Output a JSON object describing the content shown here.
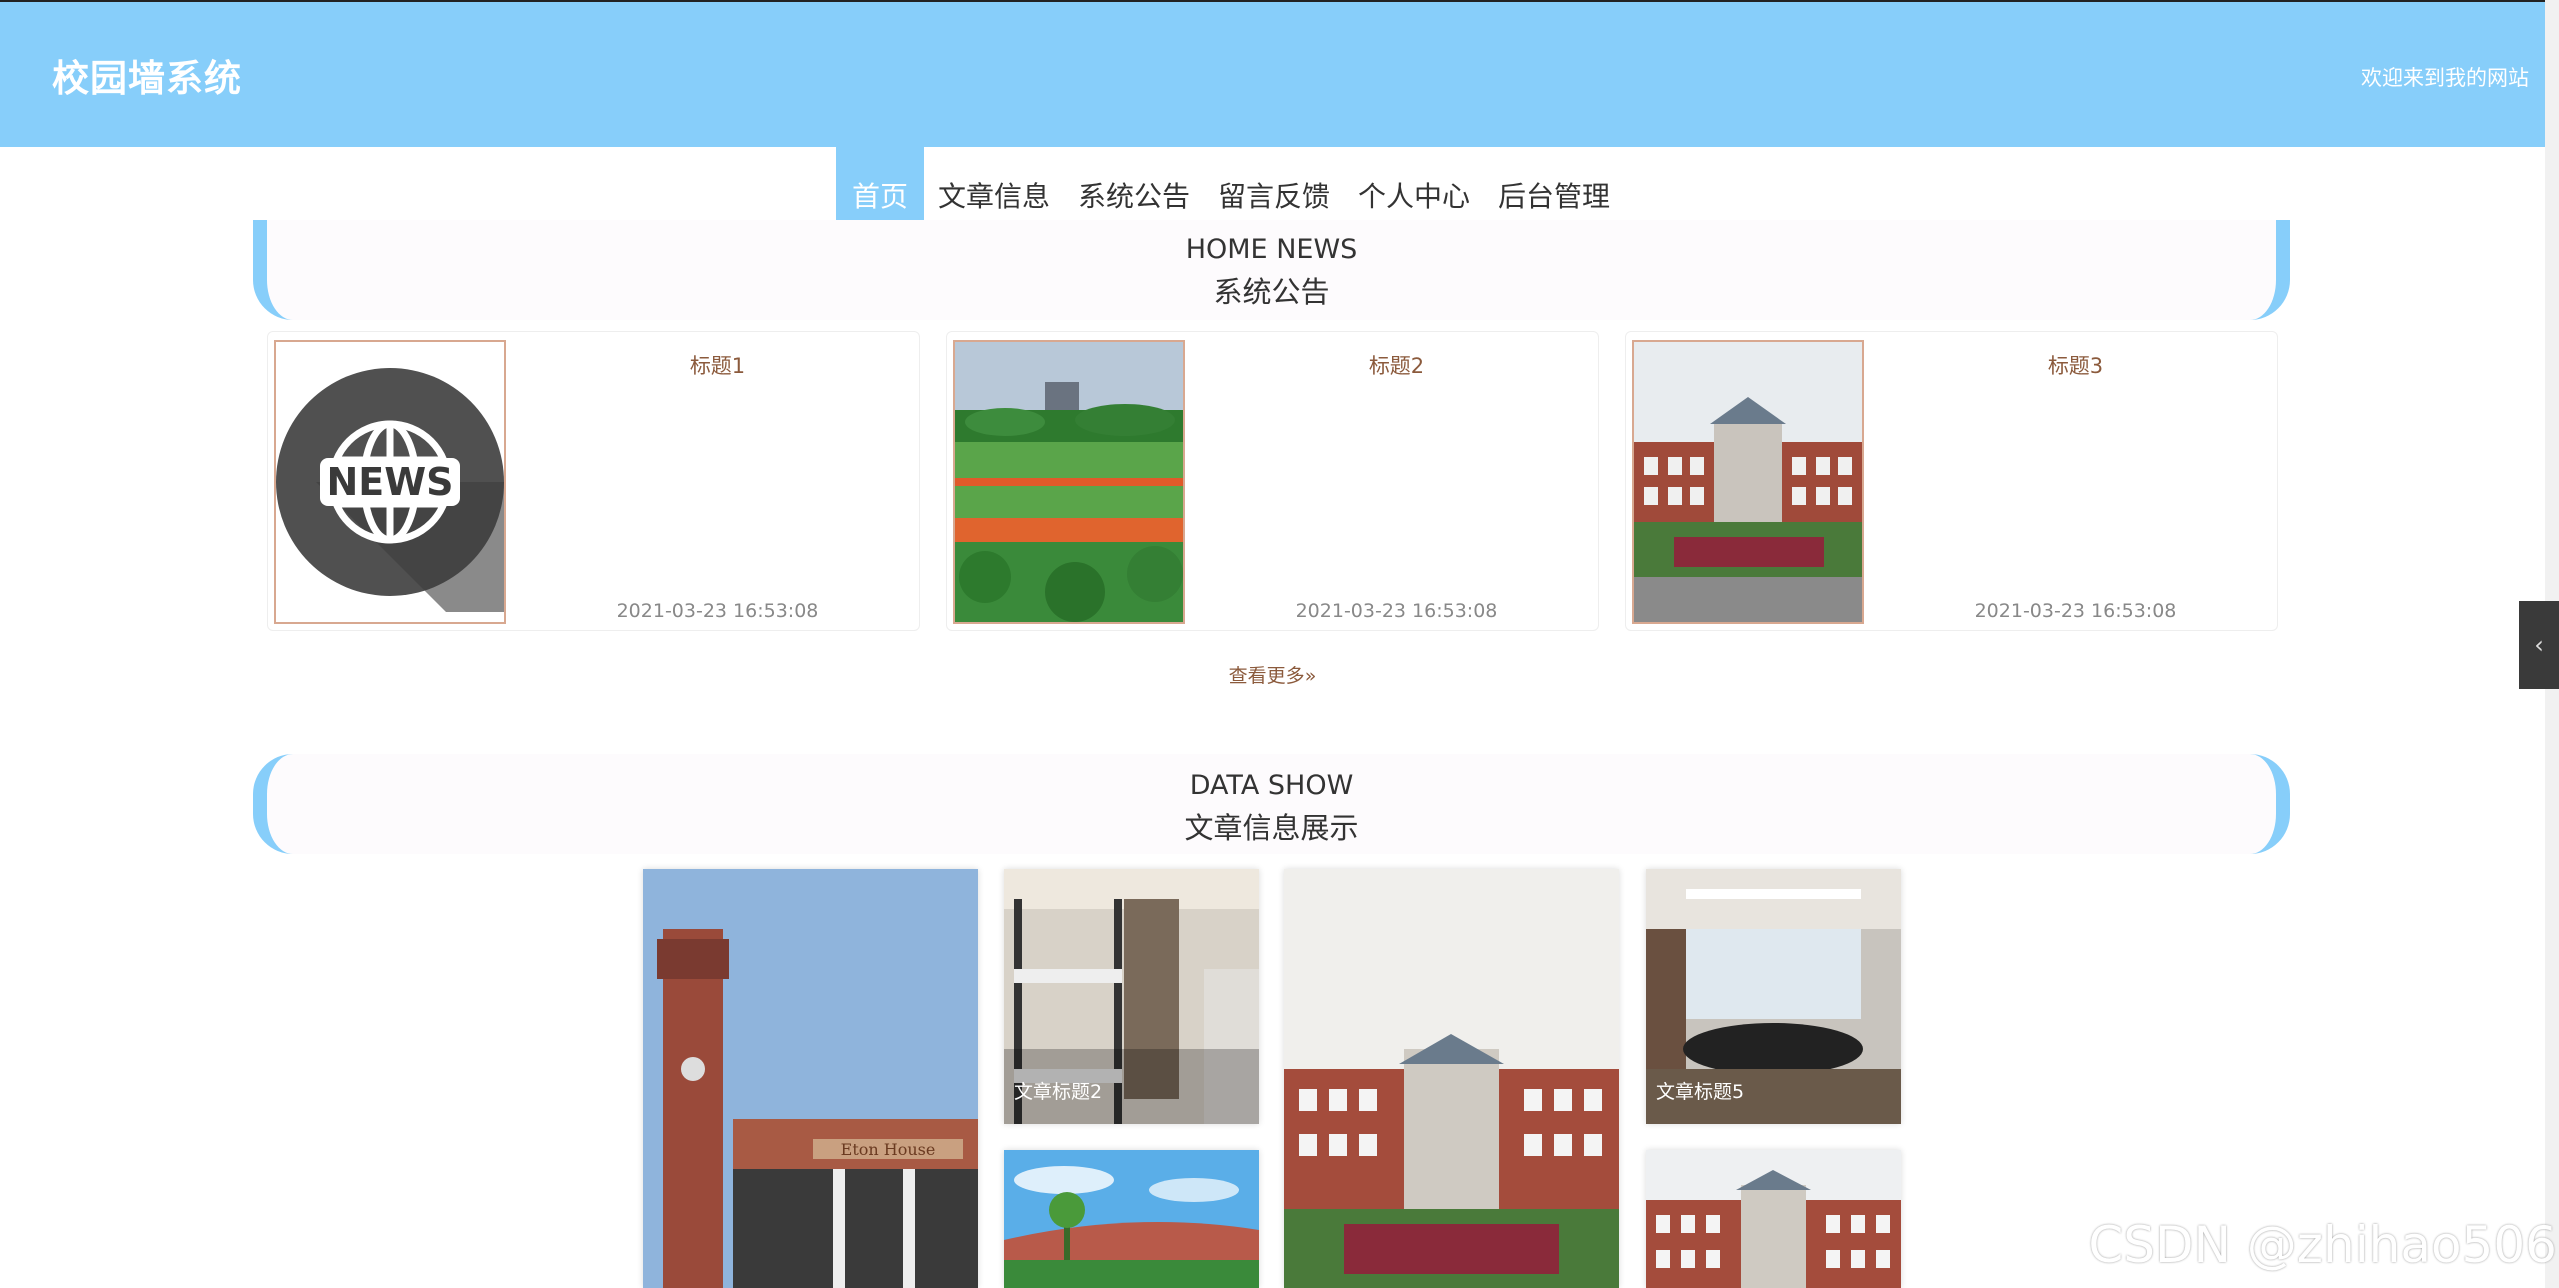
{
  "header": {
    "title": "校园墙系统",
    "welcome": "欢迎来到我的网站"
  },
  "nav": {
    "items": [
      "首页",
      "文章信息",
      "系统公告",
      "留言反馈",
      "个人中心",
      "后台管理"
    ],
    "active_index": 0
  },
  "news_section": {
    "title_en": "HOME NEWS",
    "title_cn": "系统公告",
    "cards": [
      {
        "title": "标题1",
        "time": "2021-03-23 16:53:08",
        "image": "news-globe"
      },
      {
        "title": "标题2",
        "time": "2021-03-23 16:53:08",
        "image": "sports-field"
      },
      {
        "title": "标题3",
        "time": "2021-03-23 16:53:08",
        "image": "school-building"
      }
    ],
    "more_label": "查看更多",
    "more_icon": "double-chevron-right-icon"
  },
  "data_section": {
    "title_en": "DATA SHOW",
    "title_cn": "文章信息展示",
    "tiles": [
      {
        "caption": "",
        "image": "clock-tower",
        "sign_text": "Eton House"
      },
      {
        "caption": "文章标题2",
        "image": "dormitory"
      },
      {
        "caption": "",
        "image": "campus-sky"
      },
      {
        "caption": "",
        "image": "school-building"
      },
      {
        "caption": "文章标题5",
        "image": "meeting-room"
      },
      {
        "caption": "",
        "image": "school-building"
      }
    ]
  },
  "news_logo_text": "NEWS",
  "side_toggle_icon": "chevron-left-icon",
  "watermark": "CSDN @zhihao506",
  "colors": {
    "accent": "#87cefa",
    "text_brown": "#8b5a3c",
    "date_gray": "#888888"
  }
}
